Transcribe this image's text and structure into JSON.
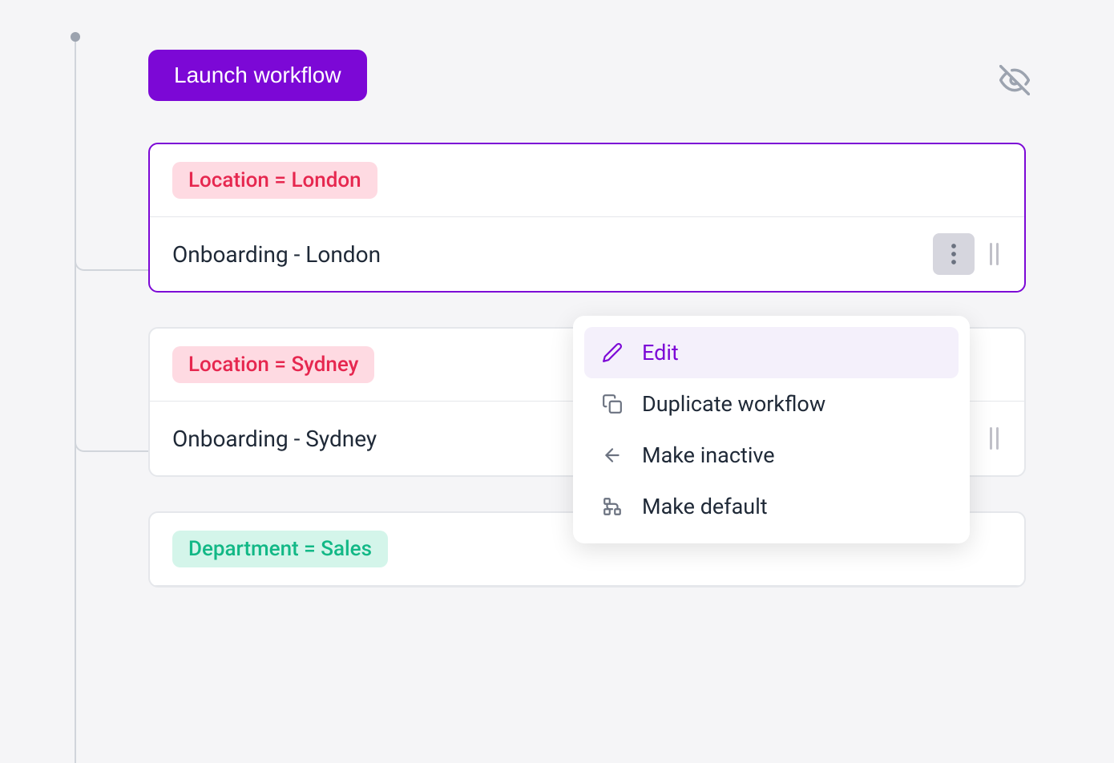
{
  "launch_button_label": "Launch workflow",
  "cards": [
    {
      "tag": "Location = London",
      "tag_style": "red",
      "title": "Onboarding - London",
      "selected": true
    },
    {
      "tag": "Location = Sydney",
      "tag_style": "red",
      "title": "Onboarding - Sydney",
      "selected": false
    },
    {
      "tag": "Department = Sales",
      "tag_style": "green",
      "title": "",
      "selected": false
    }
  ],
  "menu": {
    "items": [
      {
        "label": "Edit",
        "icon": "pencil",
        "highlighted": true
      },
      {
        "label": "Duplicate workflow",
        "icon": "copy",
        "highlighted": false
      },
      {
        "label": "Make inactive",
        "icon": "arrow-left",
        "highlighted": false
      },
      {
        "label": "Make default",
        "icon": "sitemap",
        "highlighted": false
      }
    ]
  },
  "colors": {
    "accent": "#7c08d6",
    "tag_red_bg": "#fedae2",
    "tag_red_fg": "#e6274f",
    "tag_green_bg": "#d4f5ea",
    "tag_green_fg": "#12b886"
  }
}
